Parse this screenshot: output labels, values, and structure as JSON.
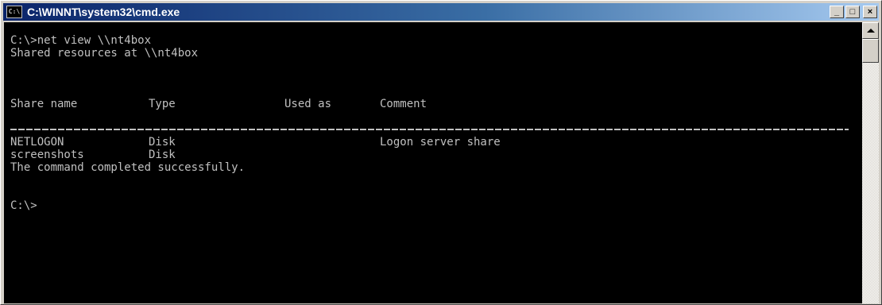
{
  "window": {
    "title": "C:\\WINNT\\system32\\cmd.exe",
    "icon": "cmd-console-icon",
    "icon_glyph": "C:\\",
    "buttons": {
      "minimize": "_",
      "maximize": "□",
      "close": "×"
    }
  },
  "console": {
    "command_line": "C:\\>net view \\\\nt4box",
    "header_line": "Shared resources at \\\\nt4box",
    "columns": [
      "Share name",
      "Type",
      "Used as",
      "Comment"
    ],
    "rows": [
      {
        "share": "NETLOGON",
        "type": "Disk",
        "used_as": "",
        "comment": "Logon server share"
      },
      {
        "share": "screenshots",
        "type": "Disk",
        "used_as": "",
        "comment": ""
      }
    ],
    "completion_line": "The command completed successfully.",
    "prompt": "C:\\>"
  },
  "colors": {
    "console_bg": "#000000",
    "console_text": "#c0c0c0",
    "titlebar_start": "#0a246a",
    "titlebar_end": "#a6caf0"
  }
}
